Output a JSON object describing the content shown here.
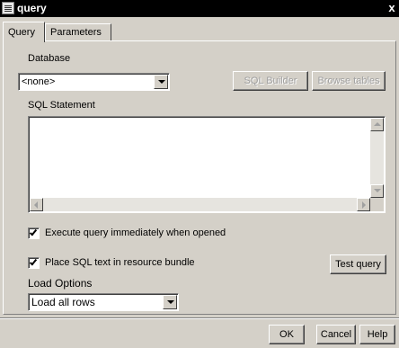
{
  "window": {
    "title": "query",
    "close_glyph": "x"
  },
  "tabs": [
    {
      "label": "Query",
      "active": true
    },
    {
      "label": "Parameters",
      "active": false
    }
  ],
  "database": {
    "label": "Database",
    "value": "<none>"
  },
  "buttons": {
    "sql_builder": "SQL Builder",
    "browse_tables": "Browse tables",
    "test_query": "Test query",
    "ok": "OK",
    "cancel": "Cancel",
    "help": "Help"
  },
  "sql_statement": {
    "label": "SQL Statement",
    "value": ""
  },
  "options": {
    "execute_immediately": {
      "label": "Execute query immediately when opened",
      "checked": true
    },
    "resource_bundle": {
      "label": "Place SQL text in resource bundle",
      "checked": true
    }
  },
  "load_options": {
    "label": "Load Options",
    "value": "Load all rows"
  },
  "colors": {
    "title_bar": "#000000",
    "dialog_bg": "#d4d0c8",
    "disabled_text": "#a0a0a0"
  },
  "icons": {
    "app": "query-window-icon",
    "dropdown": "chevron-down-icon",
    "scroll_up": "scroll-up-icon",
    "scroll_down": "scroll-down-icon",
    "scroll_left": "scroll-left-icon",
    "scroll_right": "scroll-right-icon",
    "check": "checkmark-icon"
  }
}
